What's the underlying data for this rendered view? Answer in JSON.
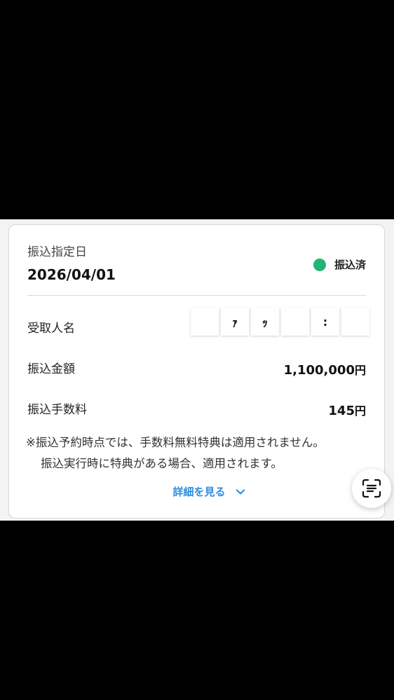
{
  "transfer": {
    "date_label": "振込指定日",
    "date_value": "2026/04/01",
    "status_text": "振込済",
    "status_color": "#22b573"
  },
  "rows": {
    "recipient_label": "受取人名",
    "recipient_masked_chars": [
      "",
      "ｧ",
      "ｯ",
      "",
      ":",
      ""
    ],
    "amount_label": "振込金額",
    "amount_value": "1,100,000",
    "amount_unit": "円",
    "fee_label": "振込手数料",
    "fee_value": "145",
    "fee_unit": "円"
  },
  "note": {
    "line1": "※振込予約時点では、手数料無料特典は適用されません。",
    "line2": "振込実行時に特典がある場合、適用されます。"
  },
  "details_link": {
    "label": "詳細を見る",
    "icon": "chevron-down-icon",
    "color": "#2f8ee0"
  },
  "scan_button": {
    "icon": "text-scan-icon"
  }
}
